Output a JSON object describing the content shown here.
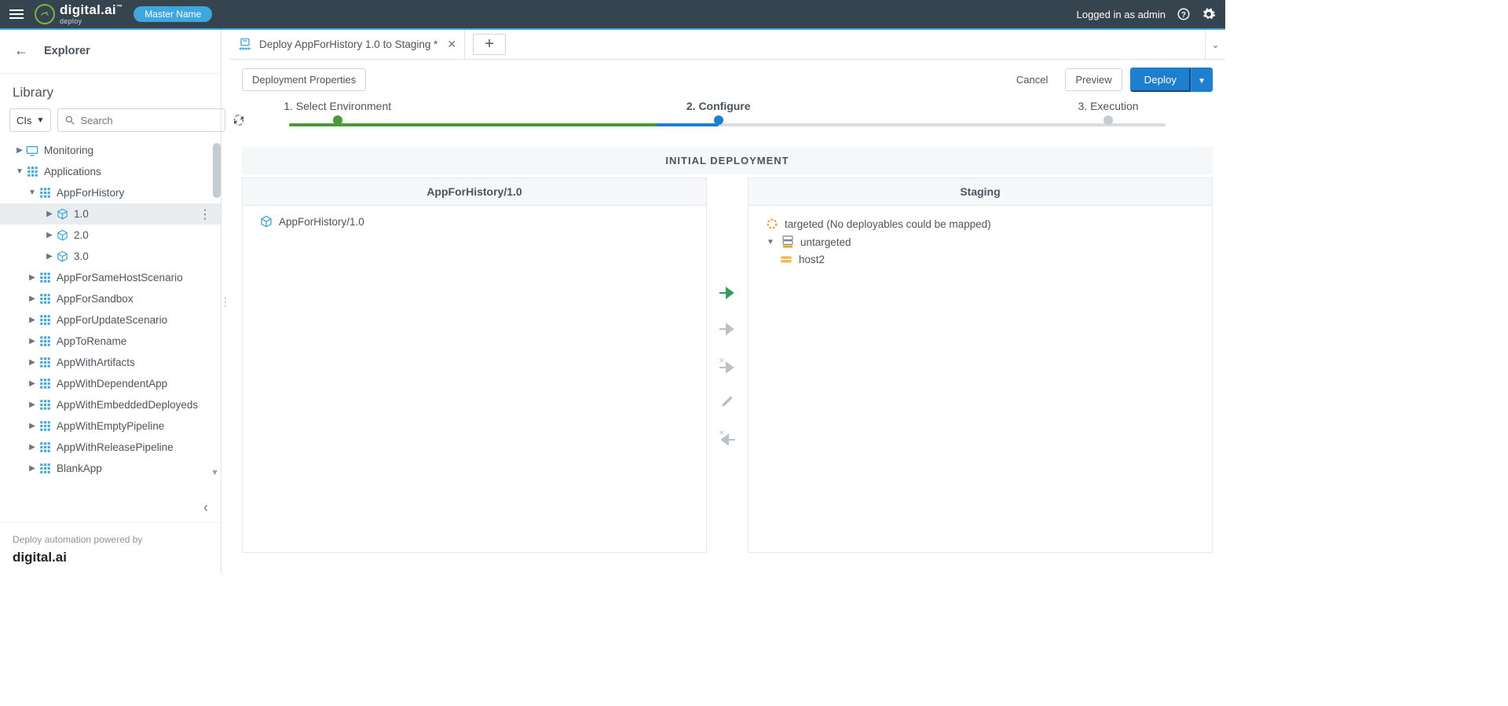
{
  "topbar": {
    "product_name": "digital.ai",
    "product_sub": "deploy",
    "master_badge": "Master Name",
    "logged_in_text": "Logged in as admin"
  },
  "sidebar": {
    "explorer_title": "Explorer",
    "library_title": "Library",
    "cls_label": "CIs",
    "search_placeholder": "Search",
    "footer_text": "Deploy automation powered by",
    "footer_brand": "digital.ai",
    "tree": {
      "monitoring": "Monitoring",
      "applications": "Applications",
      "app": "AppForHistory",
      "v1": "1.0",
      "v2": "2.0",
      "v3": "3.0",
      "a1": "AppForSameHostScenario",
      "a2": "AppForSandbox",
      "a3": "AppForUpdateScenario",
      "a4": "AppToRename",
      "a5": "AppWithArtifacts",
      "a6": "AppWithDependentApp",
      "a7": "AppWithEmbeddedDeployeds",
      "a8": "AppWithEmptyPipeline",
      "a9": "AppWithReleasePipeline",
      "a10": "BlankApp"
    }
  },
  "main": {
    "tab_title": "Deploy AppForHistory 1.0 to Staging",
    "tab_dirty_marker": "*",
    "btn_deployment_properties": "Deployment Properties",
    "btn_cancel": "Cancel",
    "btn_preview": "Preview",
    "btn_deploy": "Deploy",
    "step1": "1. Select Environment",
    "step2": "2. Configure",
    "step3": "3. Execution",
    "initial_deploy_label": "INITIAL DEPLOYMENT",
    "source_panel_title": "AppForHistory/1.0",
    "source_item": "AppForHistory/1.0",
    "target_panel_title": "Staging",
    "targeted_text": "targeted (No deployables could be mapped)",
    "untargeted_text": "untargeted",
    "host_label": "host2"
  }
}
